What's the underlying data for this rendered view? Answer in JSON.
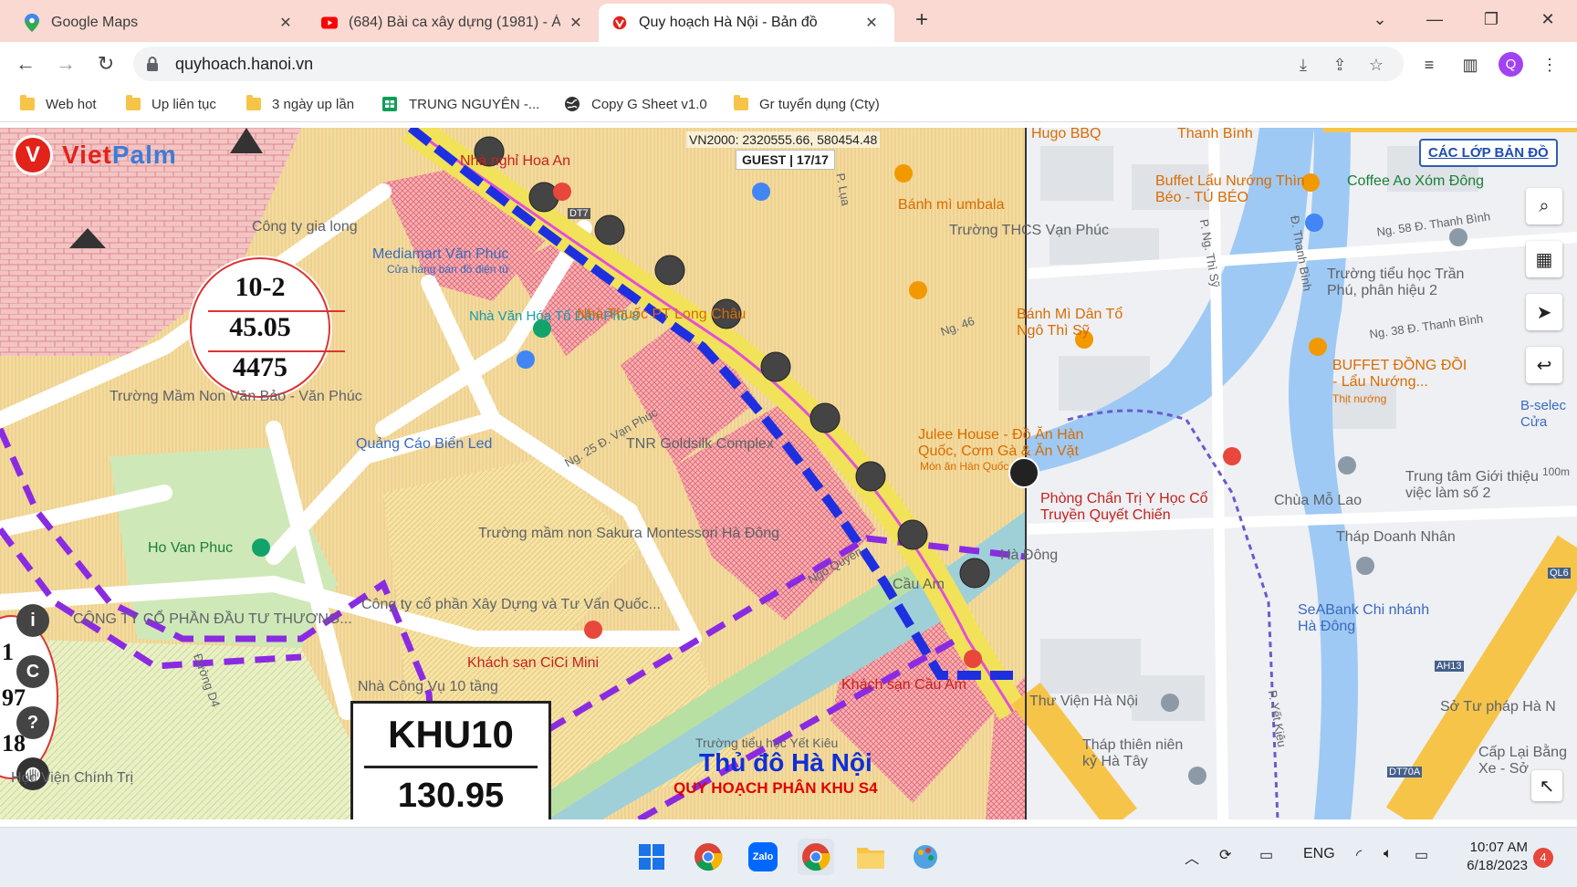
{
  "tabs": [
    {
      "title": "Google Maps",
      "icon": "google-maps-icon"
    },
    {
      "title": "(684) Bài ca xây dựng (1981) - Á",
      "icon": "youtube-icon"
    },
    {
      "title": "Quy hoạch Hà Nội - Bản đồ",
      "icon": "vietpalm-icon",
      "active": true
    }
  ],
  "address_bar": {
    "url": "quyhoach.hanoi.vn"
  },
  "profile_initial": "Q",
  "bookmarks": [
    {
      "label": "Web hot",
      "icon": "folder-icon"
    },
    {
      "label": "Up liên tục",
      "icon": "folder-icon"
    },
    {
      "label": "3 ngày up lần",
      "icon": "folder-icon"
    },
    {
      "label": "TRUNG NGUYÊN -...",
      "icon": "sheets-icon"
    },
    {
      "label": "Copy G Sheet v1.0",
      "icon": "globe-icon"
    },
    {
      "label": "Gr tuyển dụng (Cty)",
      "icon": "folder-icon"
    }
  ],
  "map": {
    "logo": {
      "part1": "Viet",
      "part2": "Palm"
    },
    "coordinates": "VN2000: 2320555.66, 580454.48",
    "guest": "GUEST | 17/17",
    "layers_button": "CÁC LỚP BẢN ĐỒ",
    "zone_circle": {
      "line1": "10-2",
      "line2": "45.05",
      "line3": "4475"
    },
    "khu_box": {
      "name": "KHU10",
      "area": "130.95"
    },
    "left_panel": {
      "line1": "1",
      "line2": "97",
      "line3": "18"
    },
    "title_main": "Thủ đô Hà Nội",
    "title_sub": "QUY HOẠCH PHÂN KHU S4",
    "plan_labels": [
      "Nhà nghỉ Hoa An",
      "Mediamart Văn Phúc",
      "Cửa hàng bán đồ điện tử",
      "Công ty gia long",
      "Nhà Văn Hóa Tổ Dân Phố 8",
      "Nhà Thuốc PT Long Châu",
      "Trường Mầm Non Văn Bảo - Văn Phúc",
      "Quảng Cáo Biển Led",
      "Ng. 25 Đ. Vạn Phúc",
      "TNR Goldsilk Complex",
      "Trường mầm non Sakura Montessori Hà Đông",
      "Ho Van Phuc",
      "Công ty cổ phần Xây Dựng và Tư Vấn Quốc...",
      "CÔNG TY CỔ PHẦN ĐẦU TƯ THƯƠNG...",
      "Khách sạn CiCi Mini",
      "Nhà Công Vụ 10 tầng",
      "Khách sạn Cầu Am",
      "Trường tiểu học Yết Kiêu",
      "Ngõ Quyên",
      "Học Viện Chính Trị",
      "Đường D4",
      "Cầu Am",
      "Hà Đông",
      "Ng. 46",
      "P. Lụa",
      "DT7"
    ],
    "google_labels": [
      "Hugo BBQ",
      "Thanh Bình",
      "Buffet Lẩu Nướng Thìn Béo - TÚ BÉO",
      "Coffee Ao Xóm Đông",
      "Bánh mì umbala",
      "Trường THCS Vạn Phúc",
      "Ng. 58 Đ. Thanh Bình",
      "Trường tiểu học Trần Phú, phân hiệu 2",
      "Ng. 38 Đ. Thanh Bình",
      "Bánh Mì Dân Tổ Ngô Thì Sỹ",
      "P. Ng. Thì Sỹ",
      "Đ. Thanh Bình",
      "BUFFET ĐỒNG ĐỒI - Lẩu Nướng...",
      "Thịt nướng",
      "B-selec Cửa",
      "Julee House - Đồ Ăn Hàn Quốc, Cơm Gà & Ăn Vặt",
      "Món ăn Hàn Quốc",
      "Phòng Chẩn Trị Y Học Cổ Truyền Quyết Chiến",
      "Chùa Mỗ Lao",
      "Trung tâm Giới thiệu việc làm số 2",
      "Tháp Doanh Nhân",
      "SeABank Chi nhánh Hà Đông",
      "Thư Viện Hà Nội",
      "Sở Tư pháp Hà N",
      "Tháp thiên niên kỷ Hà Tây",
      "P. Yết Kiêu",
      "Cấp Lại Bằng Xe - Sở",
      "AH13",
      "QL6",
      "DT70A",
      "100m"
    ]
  },
  "taskbar": {
    "language": "ENG",
    "time": "10:07 AM",
    "date": "6/18/2023",
    "notifications": "4"
  }
}
